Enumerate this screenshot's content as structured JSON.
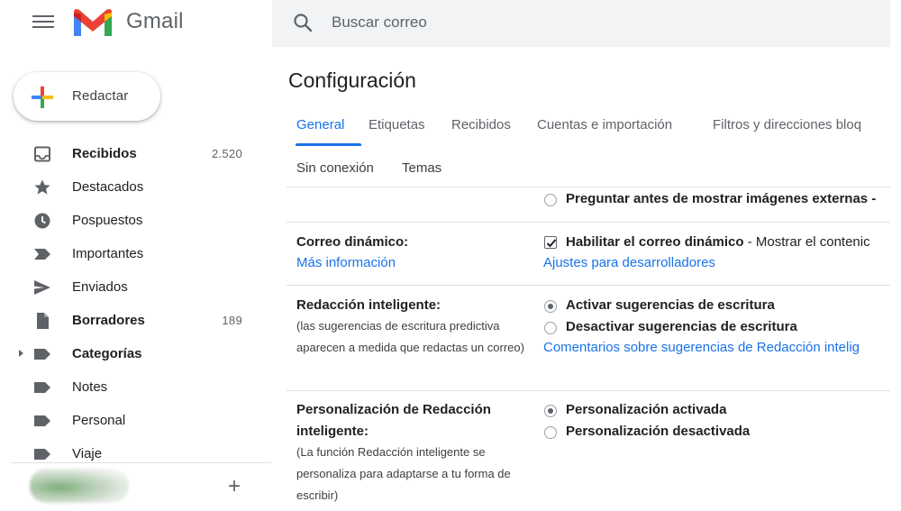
{
  "header": {
    "brand": "Gmail",
    "search_placeholder": "Buscar correo"
  },
  "compose": {
    "label": "Redactar"
  },
  "sidebar": {
    "items": [
      {
        "label": "Recibidos",
        "count": "2.520",
        "icon": "inbox-icon"
      },
      {
        "label": "Destacados",
        "count": "",
        "icon": "star-icon"
      },
      {
        "label": "Pospuestos",
        "count": "",
        "icon": "clock-icon"
      },
      {
        "label": "Importantes",
        "count": "",
        "icon": "important-icon"
      },
      {
        "label": "Enviados",
        "count": "",
        "icon": "send-icon"
      },
      {
        "label": "Borradores",
        "count": "189",
        "icon": "draft-icon"
      },
      {
        "label": "Categorías",
        "count": "",
        "icon": "label-icon"
      },
      {
        "label": "Notes",
        "count": "",
        "icon": "label-icon"
      },
      {
        "label": "Personal",
        "count": "",
        "icon": "label-icon"
      },
      {
        "label": "Viaje",
        "count": "",
        "icon": "label-icon"
      }
    ],
    "add_label": "+"
  },
  "settings": {
    "title": "Configuración",
    "tabs": [
      "General",
      "Etiquetas",
      "Recibidos",
      "Cuentas e importación",
      "Filtros y direcciones bloq"
    ],
    "tabs_row2": [
      "Sin conexión",
      "Temas"
    ],
    "images_option": "Preguntar antes de mostrar imágenes externas -",
    "dynamic": {
      "title": "Correo dinámico:",
      "link": "Más información",
      "option_bold": "Habilitar el correo dinámico",
      "option_rest": " - Mostrar el contenic",
      "dev_link": "Ajustes para desarrolladores"
    },
    "smart_compose": {
      "title": "Redacción inteligente:",
      "desc": "(las sugerencias de escritura predictiva aparecen a medida que redactas un correo)",
      "option_on": "Activar sugerencias de escritura",
      "option_off": "Desactivar sugerencias de escritura",
      "feedback_link": "Comentarios sobre sugerencias de Redacción intelig"
    },
    "personalization": {
      "title_line1": "Personalización de Redacción",
      "title_line2": "inteligente:",
      "desc": "(La función Redacción inteligente se personaliza para adaptarse a tu forma de escribir)",
      "option_on": "Personalización activada",
      "option_off": "Personalización desactivada"
    }
  },
  "colors": {
    "accent": "#1a73e8",
    "search_bg": "#f1f3f4",
    "text": "#202124",
    "muted": "#5f6368"
  }
}
